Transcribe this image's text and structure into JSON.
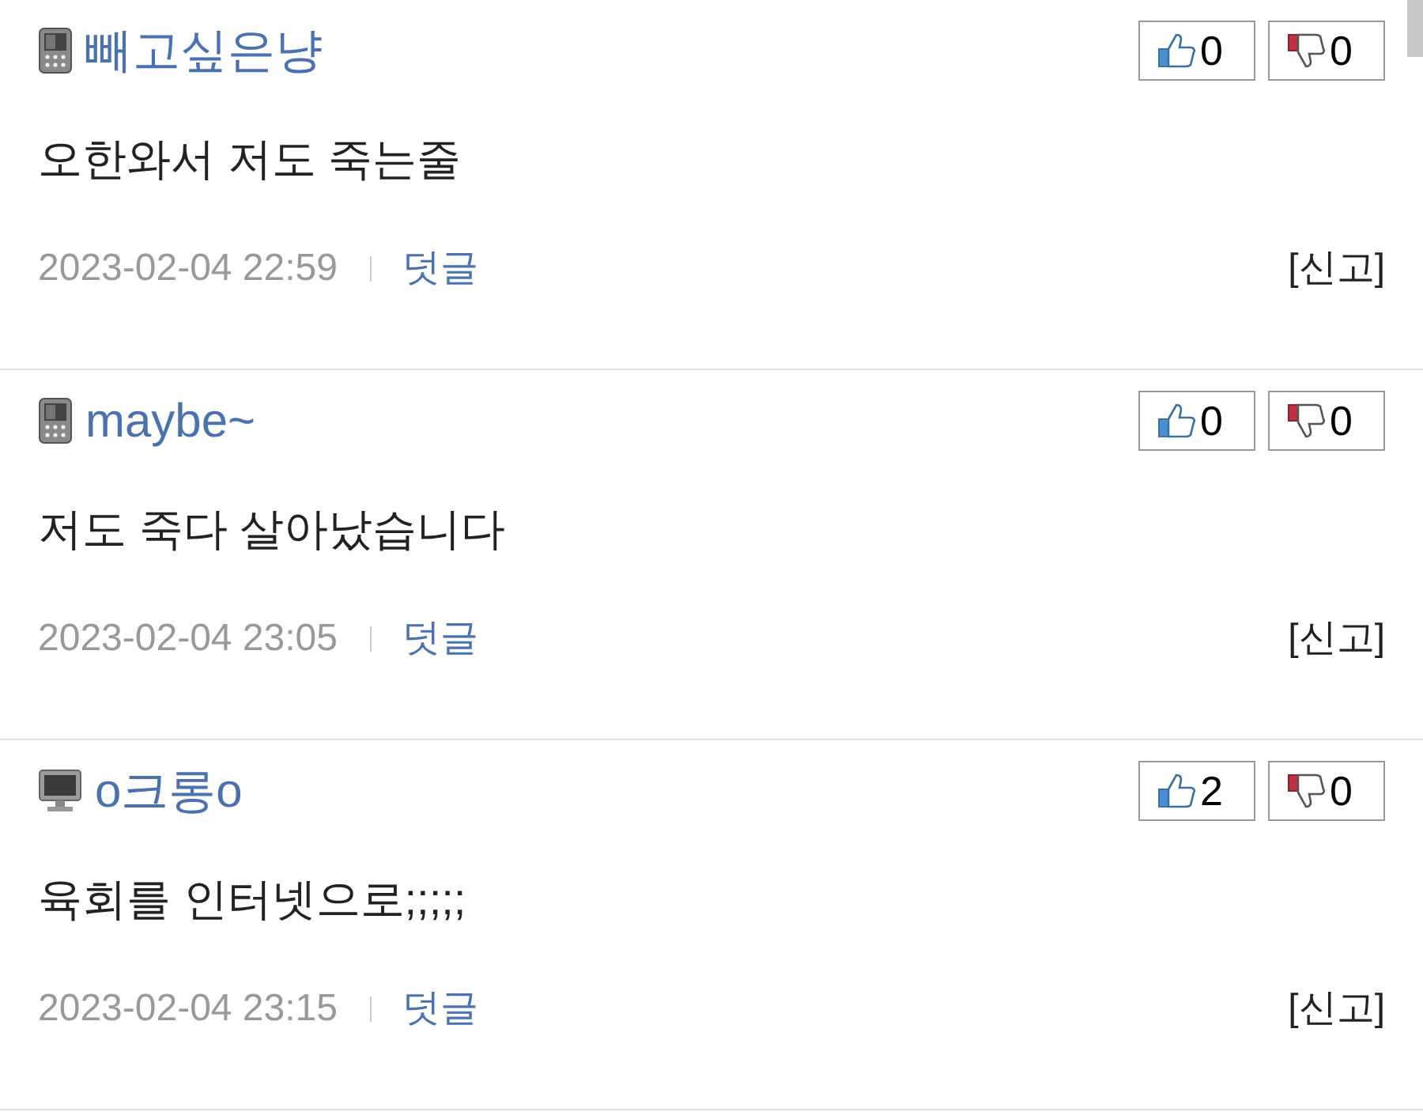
{
  "comments": [
    {
      "kind": "phone",
      "author": "빼고싶은냥",
      "likes": "0",
      "dislikes": "0",
      "text": "오한와서 저도 죽는줄",
      "date": "2023-02-04 22:59",
      "reply": "덧글",
      "report": "[신고]"
    },
    {
      "kind": "phone",
      "author": "maybe~",
      "likes": "0",
      "dislikes": "0",
      "text": "저도 죽다 살아났습니다",
      "date": "2023-02-04 23:05",
      "reply": "덧글",
      "report": "[신고]"
    },
    {
      "kind": "pc",
      "author": "o크롱o",
      "likes": "2",
      "dislikes": "0",
      "text": "육회를 인터넷으로;;;;;",
      "date": "2023-02-04 23:15",
      "reply": "덧글",
      "report": "[신고]"
    }
  ]
}
